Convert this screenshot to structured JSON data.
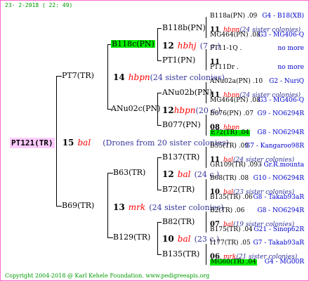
{
  "date": "23- 2-2018 ( 22: 49)",
  "copyright": "Copyright 2004-2018 @ Karl Kehele Foundation.",
  "website": "www.pedigreeapis.org",
  "root": {
    "id": "PT121(TR)",
    "count": "15",
    "breeder": "bal",
    "note": "(Drones from 20 sister colonies)"
  },
  "gen1": [
    {
      "id": "PT7(TR)",
      "count": "14",
      "breeder": "hbpn",
      "note": "(24 sister colonies)"
    },
    {
      "id": "B69(TR)",
      "count": "13",
      "breeder": "mrk",
      "note": "(24 sister colonies)"
    }
  ],
  "gen2": [
    {
      "id": "B118c(PN)",
      "count": "12",
      "breeder": "hbhj",
      "note": "(7 c.)"
    },
    {
      "id": "ANu02c(PN)",
      "count": "12",
      "breeder": "hbpn",
      "note": "(20 c.)"
    },
    {
      "id": "B63(TR)",
      "count": "12",
      "breeder": "bal",
      "note": "(24 c.)"
    },
    {
      "id": "B129(TR)",
      "count": "10",
      "breeder": "bal",
      "note": "(23 c.)"
    }
  ],
  "gen3": [
    {
      "id": "B118b(PN)"
    },
    {
      "id": "PT1(PN)"
    },
    {
      "id": "ANu02b(PN)"
    },
    {
      "id": "B077(PN)"
    },
    {
      "id": "B137(TR)"
    },
    {
      "id": "B72(TR)"
    },
    {
      "id": "B82(TR)"
    },
    {
      "id": "B135(TR)"
    }
  ],
  "gen4": [
    {
      "top": "B118a(PN) .09",
      "top_code": "G4 - B18(XB)",
      "count": "11",
      "breeder": "hbpn",
      "note": "(24 sister colonies)",
      "bottom": "MG464(PN) .08",
      "bottom_code": "G3 - MG406-Q"
    },
    {
      "top": "PT11-1Q .",
      "top_code": "no more",
      "count": "11",
      "breeder": "",
      "note": "",
      "bottom": "PT11Dr .",
      "bottom_code": "no more"
    },
    {
      "top": "ANu02a(PN) .10",
      "top_code": "G2 - NuriQ",
      "count": "11",
      "breeder": "hbpn",
      "note": "(24 sister colonies)",
      "bottom": "MG464(PN) .08",
      "bottom_code": "G3 - MG406-Q"
    },
    {
      "top": "B076(PN) .07",
      "top_code": "G9 - NO6294R",
      "count": "08",
      "breeder": "hbpn",
      "note": "",
      "bottom": "E72(TR) .04",
      "bottom_code": "G8 - NO6294R"
    },
    {
      "top": "B55(TR) .09",
      "top_code": "G7 - Kangaroo98R",
      "count": "11",
      "breeder": "bal",
      "note": "(24 sister colonies)",
      "bottom": "GR109(TR) .093",
      "bottom_code": "- Gr.R.mounta"
    },
    {
      "top": "B68(TR) .08",
      "top_code": "G10 - NO6294R",
      "count": "10",
      "breeder": "bal",
      "note": "(23 sister colonies)",
      "bottom": "B135(TR) .06",
      "bottom_code": "G8 - Takab93aR"
    },
    {
      "top": "B2(TR) .06",
      "top_code": "G8 - NO6294R",
      "count": "07",
      "breeder": "bal",
      "note": "(19 sister colonies)",
      "bottom": "B175(TR) .04",
      "bottom_code": "G21 - Sinop62R"
    },
    {
      "top": "I177(TR) .05",
      "top_code": "G7 - Takab93aR",
      "count": "06",
      "breeder": "mrk",
      "note": "(21 sister colonies)",
      "bottom": "MG60(TR) .04",
      "bottom_code": "G4 - MG00R"
    }
  ]
}
